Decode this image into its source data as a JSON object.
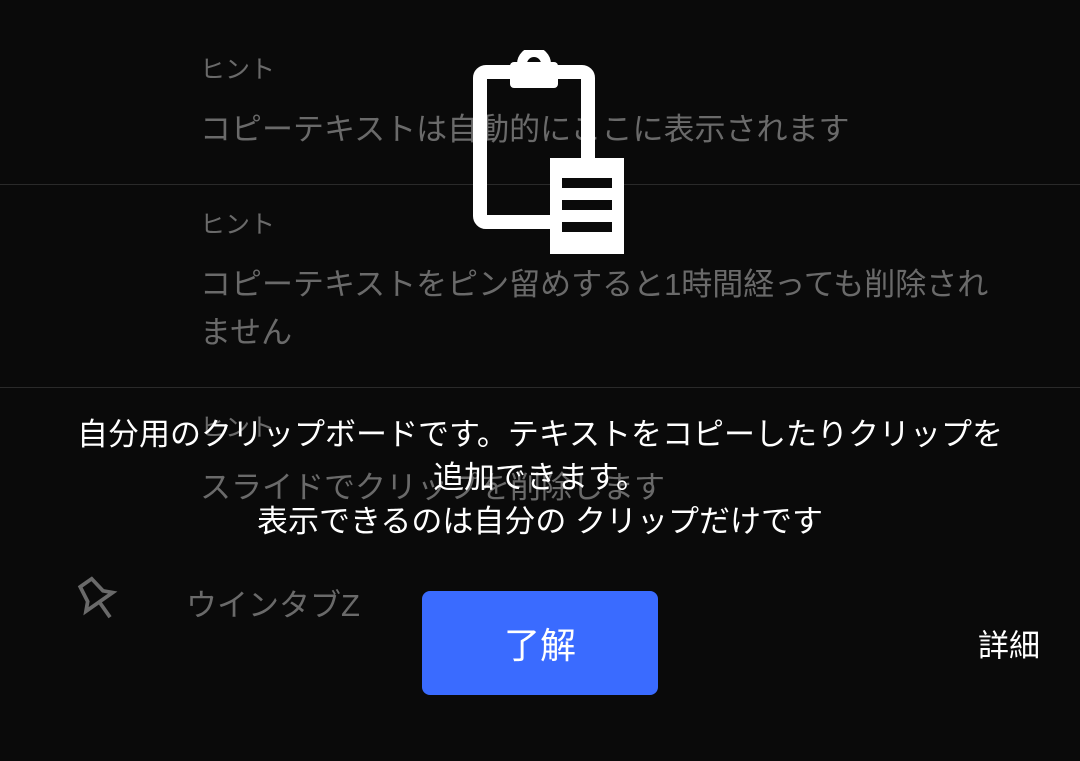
{
  "hints": [
    {
      "label": "ヒント",
      "text": "コピーテキストは自動的にここに表示されます"
    },
    {
      "label": "ヒント",
      "text": "コピーテキストをピン留めすると1時間経っても削除されません"
    },
    {
      "label": "ヒント",
      "text": "スライドでクリップを削除します"
    }
  ],
  "pinned_item": {
    "text": "ウインタブZ"
  },
  "overlay": {
    "message_line1": "自分用のクリップボードです。テキストをコピーしたりクリップを追加できます。",
    "message_line2": "表示できるのは自分の クリップだけです",
    "ok_label": "了解",
    "details_label": "詳細"
  }
}
